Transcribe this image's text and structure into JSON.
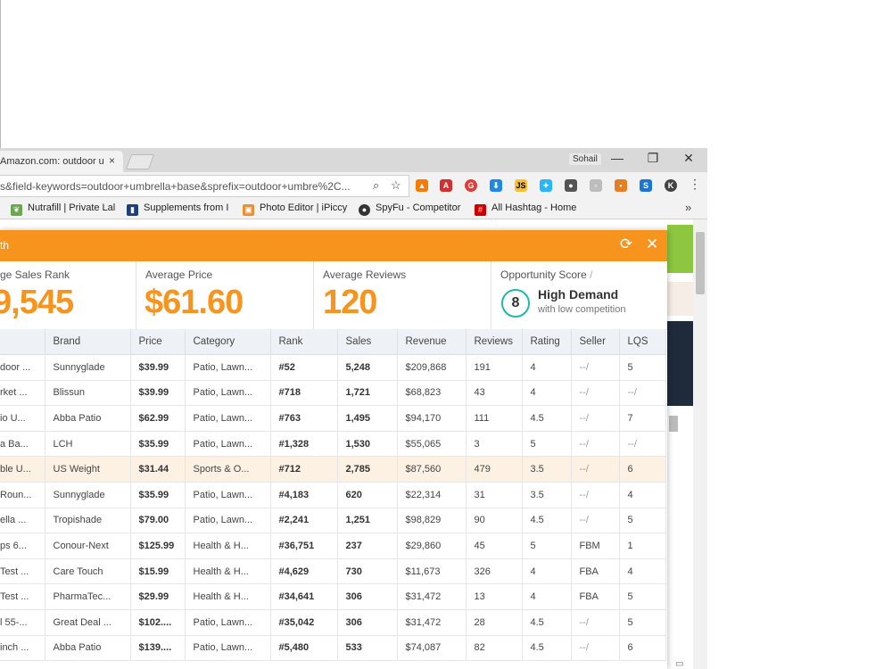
{
  "browser": {
    "tab_title": "Amazon.com: outdoor u",
    "tab_close": "×",
    "profile_name": "Sohail",
    "url": "s&field-keywords=outdoor+umbrella+base&sprefix=outdoor+umbre%2C...",
    "controls": {
      "minimize": "—",
      "restore": "❐",
      "close": "✕"
    },
    "bookmarks": [
      {
        "label": "Nutrafill | Private Lal",
        "icon": "leaf-icon",
        "color": "#6aa84f"
      },
      {
        "label": "Supplements from I",
        "icon": "bookmark-icon",
        "color": "#1f3f77"
      },
      {
        "label": "Photo Editor | iPiccy",
        "icon": "photo-icon",
        "color": "#e69138"
      },
      {
        "label": "SpyFu - Competitor",
        "icon": "spy-icon",
        "color": "#333333"
      },
      {
        "label": "All Hashtag - Home",
        "icon": "hashtag-icon",
        "color": "#cc0000"
      }
    ],
    "bookmarks_more": "»"
  },
  "panel": {
    "title": "th",
    "accent": "#f7941d",
    "stats": {
      "sales_rank_label": "ge Sales Rank",
      "sales_rank_value": "9,545",
      "price_label": "Average Price",
      "price_value": "$61.60",
      "reviews_label": "Average Reviews",
      "reviews_value": "120",
      "opportunity_label": "Opportunity Score",
      "opportunity_suffix": "/",
      "opportunity_score": "8",
      "opportunity_title": "High Demand",
      "opportunity_sub": "with low competition"
    },
    "columns": [
      "",
      "Brand",
      "Price",
      "Category",
      "Rank",
      "Sales",
      "Revenue",
      "Reviews",
      "Rating",
      "Seller",
      "LQS"
    ],
    "rows": [
      [
        "door ...",
        "Sunnyglade",
        "$39.99",
        "Patio, Lawn...",
        "#52",
        "5,248",
        "$209,868",
        "191",
        "4",
        "--/",
        "5"
      ],
      [
        "rket ...",
        "Blissun",
        "$39.99",
        "Patio, Lawn...",
        "#718",
        "1,721",
        "$68,823",
        "43",
        "4",
        "--/",
        "--/"
      ],
      [
        "io U...",
        "Abba Patio",
        "$62.99",
        "Patio, Lawn...",
        "#763",
        "1,495",
        "$94,170",
        "111",
        "4.5",
        "--/",
        "7"
      ],
      [
        "a Ba...",
        "LCH",
        "$35.99",
        "Patio, Lawn...",
        "#1,328",
        "1,530",
        "$55,065",
        "3",
        "5",
        "--/",
        "--/"
      ],
      [
        "ble U...",
        "US Weight",
        "$31.44",
        "Sports & O...",
        "#712",
        "2,785",
        "$87,560",
        "479",
        "3.5",
        "--/",
        "6"
      ],
      [
        "Roun...",
        "Sunnyglade",
        "$35.99",
        "Patio, Lawn...",
        "#4,183",
        "620",
        "$22,314",
        "31",
        "3.5",
        "--/",
        "4"
      ],
      [
        "ella ...",
        "Tropishade",
        "$79.00",
        "Patio, Lawn...",
        "#2,241",
        "1,251",
        "$98,829",
        "90",
        "4.5",
        "--/",
        "5"
      ],
      [
        "ps 6...",
        "Conour-Next",
        "$125.99",
        "Health & H...",
        "#36,751",
        "237",
        "$29,860",
        "45",
        "5",
        "FBM",
        "1"
      ],
      [
        "Test ...",
        "Care Touch",
        "$15.99",
        "Health & H...",
        "#4,629",
        "730",
        "$11,673",
        "326",
        "4",
        "FBA",
        "4"
      ],
      [
        "Test ...",
        "PharmaTec...",
        "$29.99",
        "Health & H...",
        "#34,641",
        "306",
        "$31,472",
        "13",
        "4",
        "FBA",
        "5"
      ],
      [
        "l 55-...",
        "Great Deal ...",
        "$102....",
        "Patio, Lawn...",
        "#35,042",
        "306",
        "$31,472",
        "28",
        "4.5",
        "--/",
        "5"
      ],
      [
        "inch ...",
        "Abba Patio",
        "$139....",
        "Patio, Lawn...",
        "#5,480",
        "533",
        "$74,087",
        "82",
        "4.5",
        "--/",
        "6"
      ]
    ],
    "highlight_row": 4
  }
}
